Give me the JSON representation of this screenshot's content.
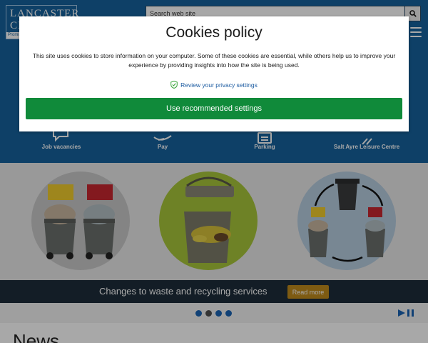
{
  "header": {
    "logo_line1": "LANCASTER",
    "logo_line2": "CI",
    "logo_tagline": "Promo",
    "search_placeholder": "Search web site",
    "search_icon": "search-icon",
    "menu_icon": "hamburger-icon"
  },
  "quick_links": [
    {
      "label": "Job vacancies",
      "icon": "chat-icon"
    },
    {
      "label": "Pay",
      "icon": "payment-icon"
    },
    {
      "label": "Parking",
      "icon": "parking-icon"
    },
    {
      "label": "Salt Ayre Leisure Centre",
      "icon": "chevron-right-icon"
    }
  ],
  "carousel": {
    "banner_text": "Changes to waste and recycling services",
    "read_more_label": "Read more",
    "slide_count": 4,
    "active_slide": 2,
    "colors": {
      "dot_active": "#1a63b4",
      "dot_inactive": "#505050",
      "banner_bg": "#1d2d3a",
      "read_more_bg": "#c08a1c"
    }
  },
  "news": {
    "heading": "News"
  },
  "cookie_modal": {
    "title": "Cookies policy",
    "text": "This site uses cookies to store information on your computer. Some of these cookies are essential, while others help us to improve your experience by providing insights into how the site is being used.",
    "privacy_link": "Review your privacy settings",
    "accept_label": "Use recommended settings",
    "colors": {
      "accept_bg": "#108a3a",
      "link": "#1a5aa0",
      "shield": "#3aa63a"
    }
  },
  "theme": {
    "brand_blue": "#16629d"
  }
}
